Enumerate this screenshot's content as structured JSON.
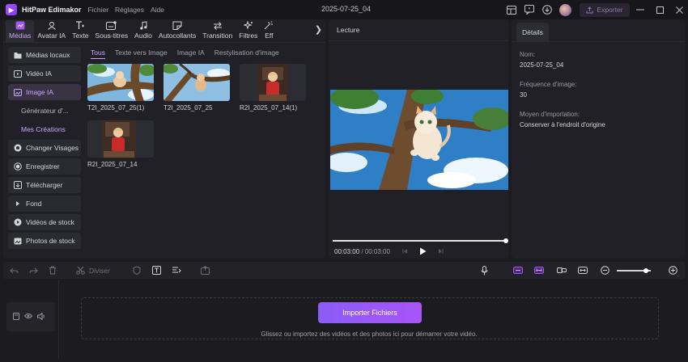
{
  "app": {
    "name": "HitPaw Edimakor",
    "menu": [
      "Fichier",
      "Réglages",
      "Aide"
    ],
    "project_title": "2025-07-25_04",
    "export_label": "Exporter"
  },
  "categories": [
    {
      "label": "Médias",
      "icon": "media-icon",
      "active": true
    },
    {
      "label": "Avatar IA",
      "icon": "avatar-ai-icon"
    },
    {
      "label": "Texte",
      "icon": "text-icon"
    },
    {
      "label": "Sous-titres",
      "icon": "subtitles-icon"
    },
    {
      "label": "Audio",
      "icon": "music-note-icon"
    },
    {
      "label": "Autocollants",
      "icon": "sticker-icon"
    },
    {
      "label": "Transition",
      "icon": "transition-icon"
    },
    {
      "label": "Filtres",
      "icon": "filter-icon"
    },
    {
      "label": "Eff",
      "icon": "effects-icon"
    }
  ],
  "sidebar": [
    {
      "label": "Médias locaux",
      "icon": "folder-icon",
      "type": "item"
    },
    {
      "label": "Vidéo IA",
      "icon": "video-ai-icon",
      "type": "item"
    },
    {
      "label": "Image IA",
      "icon": "image-ai-icon",
      "type": "item",
      "active": true
    },
    {
      "label": "Générateur d'...",
      "type": "sub"
    },
    {
      "label": "Mes Créations",
      "type": "sub",
      "active": true
    },
    {
      "label": "Changer Visages",
      "icon": "face-swap-icon",
      "type": "item"
    },
    {
      "label": "Enregistrer",
      "icon": "record-icon",
      "type": "item"
    },
    {
      "label": "Télécharger",
      "icon": "download-icon",
      "type": "item"
    },
    {
      "label": "Fond",
      "icon": "background-icon",
      "type": "item"
    },
    {
      "label": "Vidéos de stock",
      "icon": "stock-video-icon",
      "type": "item"
    },
    {
      "label": "Photos de stock",
      "icon": "stock-photo-icon",
      "type": "item"
    }
  ],
  "subtabs": [
    {
      "label": "Tous",
      "active": true
    },
    {
      "label": "Texte vers Image"
    },
    {
      "label": "Image IA"
    },
    {
      "label": "Restylisation d'image"
    }
  ],
  "media_items": [
    {
      "label": "T2I_2025_07_25(1)",
      "kind": "cat-tree"
    },
    {
      "label": "T2I_2025_07_25",
      "kind": "cat-tree-2"
    },
    {
      "label": "R2I_2025_07_14(1)",
      "kind": "child"
    },
    {
      "label": "R2I_2025_07_14",
      "kind": "child"
    }
  ],
  "preview": {
    "title": "Lecture",
    "time_current": "00:03:00",
    "time_separator": " / ",
    "time_total": "00:03:00",
    "progress": 1.0
  },
  "details": {
    "tab": "Détails",
    "name_label": "Nom:",
    "name_value": "2025-07-25_04",
    "fps_label": "Fréquence d'image:",
    "fps_value": "30",
    "import_label": "Moyen d'importation:",
    "import_value": "Conserver à l'endroit d'origine"
  },
  "timeline": {
    "split_label": "Diviser",
    "zoom_level": 0.85,
    "import_button": "Importer Fichiers",
    "hint": "Glissez ou importez des vidéos et des photos ici pour démarrer votre vidéo."
  },
  "colors": {
    "accent": "#a855f7",
    "accent_text": "#c7a6ff",
    "panel": "#202026",
    "background": "#1b1b20"
  }
}
